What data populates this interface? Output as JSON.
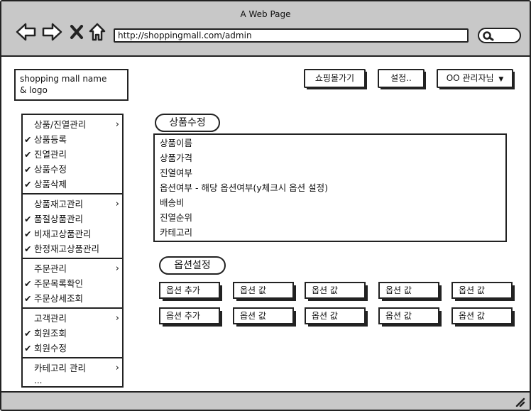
{
  "window": {
    "title": "A Web Page"
  },
  "browser": {
    "url": "http://shoppingmall.com/admin",
    "icons": [
      "back-arrow-icon",
      "forward-arrow-icon",
      "close-x-icon",
      "home-icon",
      "search-icon"
    ]
  },
  "header": {
    "logo_text": "shopping mall name\n& logo",
    "buttons": [
      {
        "label": "쇼핑몰가기"
      },
      {
        "label": "설정.."
      },
      {
        "label": "OO 관리자님",
        "dropdown": "▼"
      }
    ]
  },
  "sidebar": {
    "groups": [
      {
        "title": "상품/진열관리",
        "chevron": "›",
        "items": [
          "상품등록",
          "진열관리",
          "상품수정",
          "상품삭제"
        ]
      },
      {
        "title": "상품재고관리",
        "chevron": "›",
        "items": [
          "품절상품관리",
          "비재고상품관리",
          "한정재고상품관리"
        ]
      },
      {
        "title": "주문관리",
        "chevron": "›",
        "items": [
          "주문목록확인",
          "주문상세조회"
        ]
      },
      {
        "title": "고객관리",
        "chevron": "›",
        "items": [
          "회원조회",
          "회원수정"
        ]
      },
      {
        "title": "카테고리 관리",
        "chevron": "›",
        "items": [],
        "more": "..."
      }
    ],
    "check_mark": "✔"
  },
  "product_edit": {
    "label": "상품수정",
    "fields": [
      "상품이름",
      "상품가격",
      "진열여부",
      "옵션여부 - 해당 옵션여부(y체크시 옵션 설정)",
      "배송비",
      "진열순위",
      "카테고리"
    ]
  },
  "option_settings": {
    "label": "옵션설정",
    "rows": [
      [
        "옵션 추가",
        "옵션 값",
        "옵션 값",
        "옵션 값",
        "옵션 값"
      ],
      [
        "옵션 추가",
        "옵션 값",
        "옵션 값",
        "옵션 값",
        "옵션 값"
      ]
    ]
  }
}
